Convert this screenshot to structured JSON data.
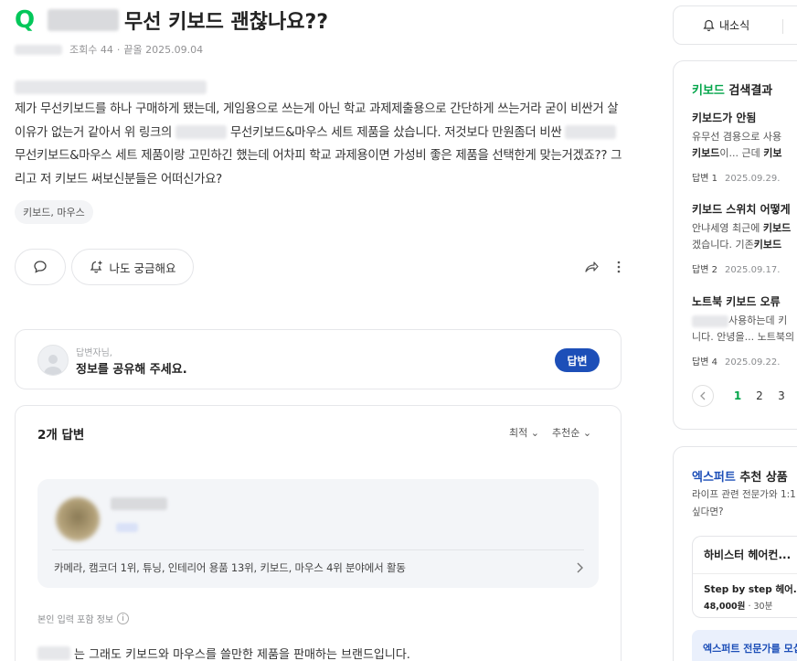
{
  "question": {
    "mark": "Q",
    "title": "무선 키보드 괜찮나요??",
    "views": "조회수 44",
    "date": "끝올 2025.09.04",
    "body_part1": "제가 무선키보드를 하나 구매하게 됐는데, 게임용으로 쓰는게 아닌 학교 과제제출용으로 간단하게 쓰는거라 굳이 비싼거 살 이유가 없는거 같아서 위 링크의",
    "body_part2": "무선키보드&마우스 세트 제품을 샀습니다. 저것보다 만원좀더 비싼",
    "body_part3": "무선키보드&마우스 세트 제품이랑 고민하긴 했는데 어차피 학교 과제용이면 가성비 좋은 제품을 선택한게 맞는거겠죠?? 그리고 저 키보드 써보신분들은 어떠신가요?",
    "tag": "키보드, 마우스",
    "curious_label": "나도 궁금해요"
  },
  "answer_prompt": {
    "sub": "답변자님,",
    "main": "정보를 공유해 주세요.",
    "button": "답변"
  },
  "answers": {
    "count": "2개 답변",
    "sort_latest": "최적",
    "sort_reco": "추천순",
    "expert_field": "카메라, 캠코더 1위, 튜닝, 인테리어 용품 13위, 키보드, 마우스 4위 분야에서 활동",
    "self_info": "본인 입력 포함 정보",
    "first_text": "는 그래도 키보드와 마우스를 쓸만한 제품을 판매하는 브랜드입니다."
  },
  "sidebar": {
    "notice": "내소식",
    "search": {
      "keyword": "키보드",
      "title_rest": " 검색결과",
      "results": [
        {
          "title": "키보드가 안됨",
          "line1_pre": "유무선 겸용으로 사용",
          "line2_b": "키보드",
          "line2_rest": "이... 근데 ",
          "line2_b2": "키보",
          "answers": "답변 1",
          "date": "2025.09.29."
        },
        {
          "title": "키보드 스위치 어떻게",
          "line1_pre": "안냐세영 최근에 ",
          "line1_b": "키보드",
          "line2_pre": "겠습니다. 기존",
          "line2_b": "키보드",
          "answers": "답변 2",
          "date": "2025.09.17."
        },
        {
          "title": "노트북 키보드 오류",
          "line1_pre": "사용하는데 키",
          "line2_pre": "니다. 안녕을... 노트북의",
          "answers": "답변 4",
          "date": "2025.09.22."
        }
      ],
      "pages": [
        "1",
        "2",
        "3"
      ]
    },
    "expert": {
      "keyword": "엑스퍼트",
      "title_rest": " 추천 상품",
      "sub1": "라이프 관련 전문가와 1:1",
      "sub2": "싶다면?",
      "product_name": "하비스터 헤어컨...",
      "product_line": "Step by step 헤어...",
      "price": "48,000원",
      "duration": "· 30분",
      "banner": "엑스퍼트 전문가를 모십니다"
    }
  }
}
